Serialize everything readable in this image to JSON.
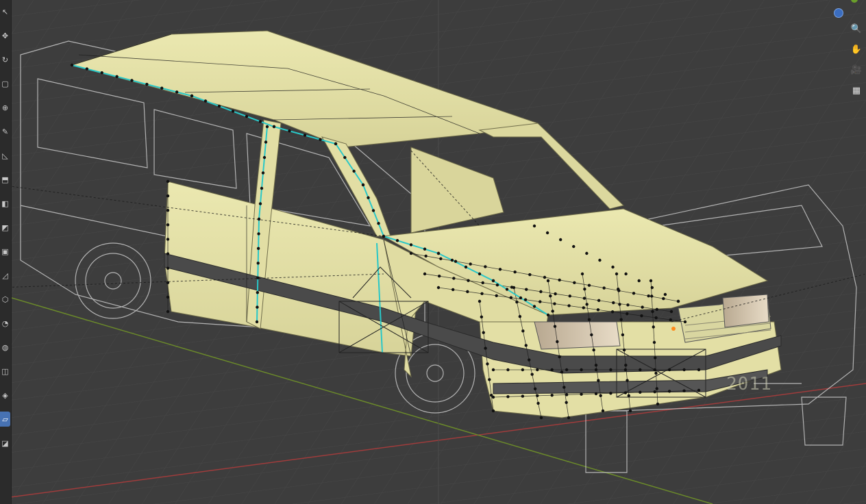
{
  "app": "3D Viewport",
  "blueprint_text": "2011",
  "toolbar": {
    "tools": [
      {
        "name": "cursor-tool",
        "icon": "cursor-arrow-icon",
        "glyph": "↖"
      },
      {
        "name": "move-tool",
        "icon": "move-icon",
        "glyph": "✥"
      },
      {
        "name": "rotate-tool",
        "icon": "rotate-icon",
        "glyph": "↻"
      },
      {
        "name": "scale-tool",
        "icon": "scale-icon",
        "glyph": "▢"
      },
      {
        "name": "transform-tool",
        "icon": "transform-icon",
        "glyph": "⊕"
      },
      {
        "name": "annotate-tool",
        "icon": "annotate-icon",
        "glyph": "✎"
      },
      {
        "name": "measure-tool",
        "icon": "measure-icon",
        "glyph": "◺"
      },
      {
        "name": "extrude-tool",
        "icon": "extrude-icon",
        "glyph": "⬒"
      },
      {
        "name": "inset-tool",
        "icon": "inset-icon",
        "glyph": "◧"
      },
      {
        "name": "bevel-tool",
        "icon": "bevel-icon",
        "glyph": "◩"
      },
      {
        "name": "loop-cut-tool",
        "icon": "loop-cut-icon",
        "glyph": "▣"
      },
      {
        "name": "knife-tool",
        "icon": "knife-icon",
        "glyph": "◿"
      },
      {
        "name": "poly-build-tool",
        "icon": "poly-build-icon",
        "glyph": "⬡"
      },
      {
        "name": "spin-tool",
        "icon": "spin-icon",
        "glyph": "◔"
      },
      {
        "name": "smooth-tool",
        "icon": "smooth-icon",
        "glyph": "◍"
      },
      {
        "name": "edge-slide-tool",
        "icon": "edge-slide-icon",
        "glyph": "◫"
      },
      {
        "name": "shrink-fatten-tool",
        "icon": "shrink-fatten-icon",
        "glyph": "◈"
      },
      {
        "name": "shear-tool",
        "icon": "shear-icon",
        "glyph": "▱"
      },
      {
        "name": "rip-tool",
        "icon": "rip-icon",
        "glyph": "◪"
      }
    ],
    "active_index": 17
  },
  "navigation": {
    "buttons": [
      {
        "name": "zoom-button",
        "icon": "zoom-icon",
        "glyph": "🔍"
      },
      {
        "name": "pan-button",
        "icon": "hand-icon",
        "glyph": "✋"
      },
      {
        "name": "camera-button",
        "icon": "camera-icon",
        "glyph": "🎥"
      },
      {
        "name": "perspective-button",
        "icon": "grid-icon",
        "glyph": "▦"
      }
    ]
  },
  "colors": {
    "background": "#3d3d3d",
    "grid": "#474747",
    "body": "#e6e3a6",
    "body_shade": "#cfcb8e",
    "vertex": "#111111",
    "seam": "#29c7c7",
    "x_axis": "#a03c3c",
    "y_axis": "#6b8a2a",
    "blueprint": "#c9c9c9"
  }
}
